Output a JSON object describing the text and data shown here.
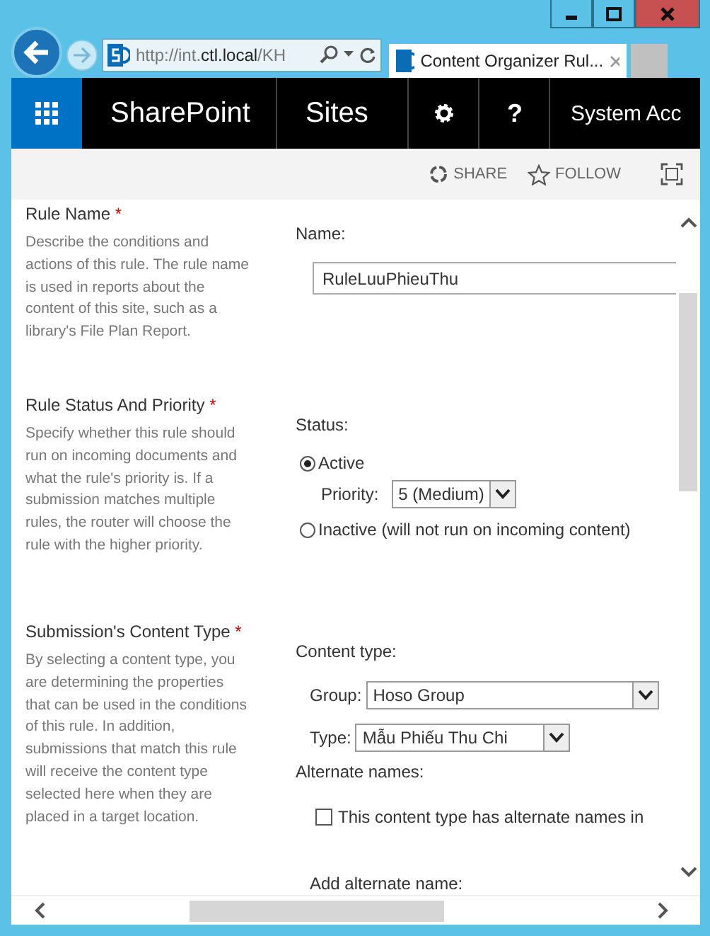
{
  "browser": {
    "address": "http://int.**ctl.local**/KH",
    "tab": {
      "title": "Content Organizer Rul...",
      "selected": true
    }
  },
  "suite_bar": {
    "brand": "SharePoint",
    "link": "Sites",
    "help": "?",
    "user": "System Acc"
  },
  "actions": [
    "SHARE",
    "FOLLOW"
  ],
  "sections": [
    {
      "kind": "name",
      "title": "Rule Name",
      "required_mark": "*",
      "description": "Describe the conditions and actions of this rule. The rule name is used in reports about the content of this site, such as a library's File Plan Report.",
      "label": "Name:",
      "value": "RuleLuuPhieuThu"
    },
    {
      "kind": "status",
      "title": "Rule Status And Priority",
      "required_mark": "*",
      "description": "Specify whether this rule should run on incoming documents and what the rule's priority is. If a submission matches multiple rules, the router will choose the rule with the higher priority.",
      "label": "Status:",
      "options": [
        {
          "label": "Active",
          "selected": true
        },
        {
          "label": "Inactive (will not run on incoming content)",
          "selected": false
        }
      ],
      "priority": {
        "label": "Priority:",
        "value": "5 (Medium)"
      }
    },
    {
      "kind": "content_type",
      "title": "Submission's Content Type",
      "required_mark": "*",
      "description": "By selecting a content type, you are determining the properties that can be used in the conditions of this rule. In addition, submissions that match this rule will receive the content type selected here when they are placed in a target location.",
      "label": "Content type:",
      "group": {
        "label": "Group:",
        "value": "Hoso Group"
      },
      "type": {
        "label": "Type:",
        "value": "Mẫu Phiếu Thu Chi"
      },
      "alternate_label": "Alternate names:",
      "checkbox": {
        "label": "This content type has alternate names in",
        "checked": false
      },
      "add_label": "Add alternate name:"
    }
  ]
}
